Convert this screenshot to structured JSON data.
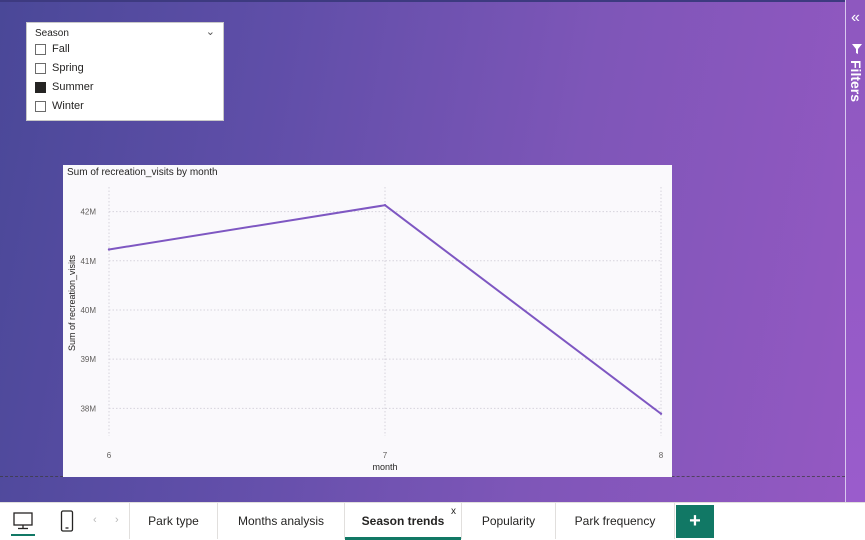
{
  "slicer": {
    "header": "Season",
    "items": [
      {
        "label": "Fall",
        "checked": false
      },
      {
        "label": "Spring",
        "checked": false
      },
      {
        "label": "Summer",
        "checked": true
      },
      {
        "label": "Winter",
        "checked": false
      }
    ]
  },
  "filters_pane": {
    "label": "Filters",
    "collapse_glyph": "«"
  },
  "chart_data": {
    "type": "line",
    "title": "Sum of recreation_visits by month",
    "xlabel": "month",
    "ylabel": "Sum of recreation_visits",
    "x": [
      6,
      7,
      8
    ],
    "x_tick_labels": [
      "6",
      "7",
      "8"
    ],
    "y_ticks": [
      38000000,
      39000000,
      40000000,
      41000000,
      42000000
    ],
    "y_tick_labels": [
      "38M",
      "39M",
      "40M",
      "41M",
      "42M"
    ],
    "ylim": [
      37600000,
      42500000
    ],
    "xlim": [
      6,
      8
    ],
    "series": [
      {
        "values": [
          41230000,
          42130000,
          37890000
        ],
        "color": "#7e57c2"
      }
    ],
    "grid": true
  },
  "tabs": [
    {
      "label": "Park type",
      "active": false
    },
    {
      "label": "Months analysis",
      "active": false
    },
    {
      "label": "Season trends",
      "active": true,
      "close": "x"
    },
    {
      "label": "Popularity",
      "active": false
    },
    {
      "label": "Park frequency",
      "active": false
    }
  ],
  "tabbar": {
    "add_label": "+",
    "prev": "‹",
    "next": "›"
  },
  "colors": {
    "accent": "#117865",
    "line": "#7e57c2"
  }
}
